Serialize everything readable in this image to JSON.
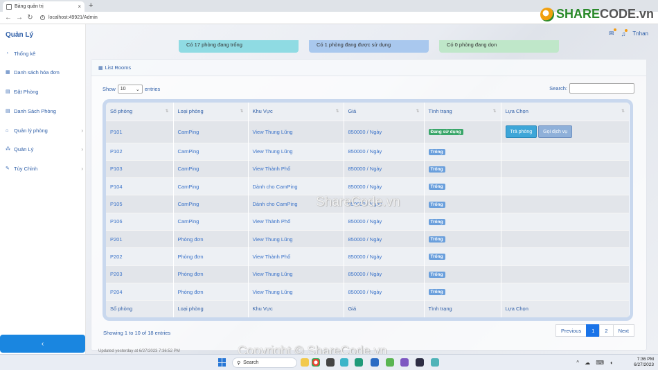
{
  "browser": {
    "tab_title": "Bảng quản trị",
    "tab_close": "×",
    "new_tab": "+",
    "url": "localhost:49921/Admin"
  },
  "sidebar": {
    "brand": "Quản Lý",
    "items": [
      {
        "label": "Thống kê",
        "icon": "dashboard-icon",
        "chevron": false
      },
      {
        "label": "Danh sách hóa đơn",
        "icon": "chart-icon",
        "chevron": false
      },
      {
        "label": "Đặt Phòng",
        "icon": "table-icon",
        "chevron": false
      },
      {
        "label": "Danh Sách Phòng",
        "icon": "table-icon",
        "chevron": false
      },
      {
        "label": "Quản lý phòng",
        "icon": "home-icon",
        "chevron": true
      },
      {
        "label": "Quản Lý",
        "icon": "sitemap-icon",
        "chevron": true
      },
      {
        "label": "Tùy Chỉnh",
        "icon": "wrench-icon",
        "chevron": true
      }
    ],
    "collapse_label": "‹"
  },
  "topbar": {
    "user": "Tnhan"
  },
  "stats": [
    {
      "text": "Có 17 phòng đang trống",
      "color": "#8fdbe3"
    },
    {
      "text": "Có 1 phòng đang được sử dụng",
      "color": "#a9c8ee"
    },
    {
      "text": "Có 0 phòng đang dọn",
      "color": "#bfe7c9"
    }
  ],
  "panel": {
    "title": "List Rooms",
    "show_label": "Show",
    "page_size": "10",
    "entries_label": "entries",
    "search_label": "Search:"
  },
  "table": {
    "columns": [
      "Số phòng",
      "Loại phòng",
      "Khu Vực",
      "Giá",
      "Tình trạng",
      "Lựa Chọn"
    ],
    "rows": [
      {
        "room": "P101",
        "type": "CamPing",
        "area": "View Thung Lũng",
        "price": "850000 / Ngày",
        "status": "Đang sử dụng",
        "used": true
      },
      {
        "room": "P102",
        "type": "CamPing",
        "area": "View Thung Lũng",
        "price": "850000 / Ngày",
        "status": "Trống",
        "used": false
      },
      {
        "room": "P103",
        "type": "CamPing",
        "area": "View Thành Phố",
        "price": "850000 / Ngày",
        "status": "Trống",
        "used": false
      },
      {
        "room": "P104",
        "type": "CamPing",
        "area": "Dành cho CamPing",
        "price": "850000 / Ngày",
        "status": "Trống",
        "used": false
      },
      {
        "room": "P105",
        "type": "CamPing",
        "area": "Dành cho CamPing",
        "price": "850000 / Ngày",
        "status": "Trống",
        "used": false
      },
      {
        "room": "P106",
        "type": "CamPing",
        "area": "View Thành Phố",
        "price": "850000 / Ngày",
        "status": "Trống",
        "used": false
      },
      {
        "room": "P201",
        "type": "Phòng đơn",
        "area": "View Thung Lũng",
        "price": "850000 / Ngày",
        "status": "Trống",
        "used": false
      },
      {
        "room": "P202",
        "type": "Phòng đơn",
        "area": "View Thành Phố",
        "price": "850000 / Ngày",
        "status": "Trống",
        "used": false
      },
      {
        "room": "P203",
        "type": "Phòng đơn",
        "area": "View Thung Lũng",
        "price": "850000 / Ngày",
        "status": "Trống",
        "used": false
      },
      {
        "room": "P204",
        "type": "Phòng đơn",
        "area": "View Thung Lũng",
        "price": "850000 / Ngày",
        "status": "Trống",
        "used": false
      }
    ],
    "actions": {
      "return": "Trả phòng",
      "service": "Gọi dịch vụ"
    }
  },
  "footer": {
    "info": "Showing 1 to 10 of 18 entries",
    "pages": [
      "Previous",
      "1",
      "2",
      "Next"
    ],
    "active_page": "1",
    "updated": "Updated yesterday at 6/27/2023 7:36:52 PM"
  },
  "watermark": {
    "center": "ShareCode.vn",
    "bottom": "Copyright © ShareCode.vn",
    "logo_part1": "SHARE",
    "logo_part2": "CODE.vn"
  },
  "taskbar": {
    "search": "Search",
    "time": "7:36 PM",
    "date": "6/27/2023",
    "notif_count": "2"
  }
}
